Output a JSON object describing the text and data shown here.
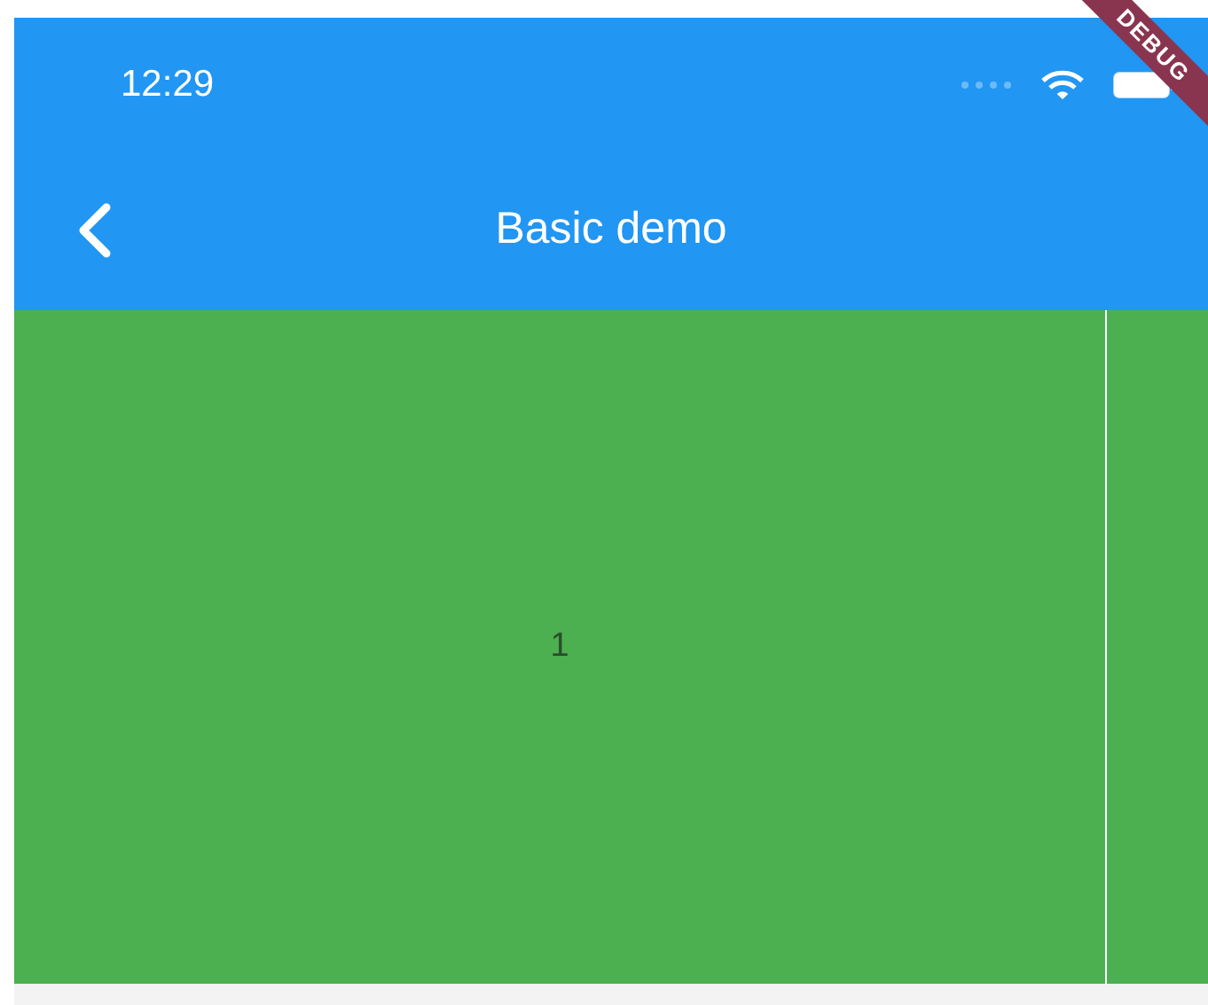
{
  "status_bar": {
    "time": "12:29"
  },
  "app_bar": {
    "title": "Basic demo"
  },
  "debug_banner": {
    "label": "DEBUG"
  },
  "pages": [
    {
      "label": "1",
      "color": "#4caf50"
    },
    {
      "color": "#4caf50"
    }
  ]
}
